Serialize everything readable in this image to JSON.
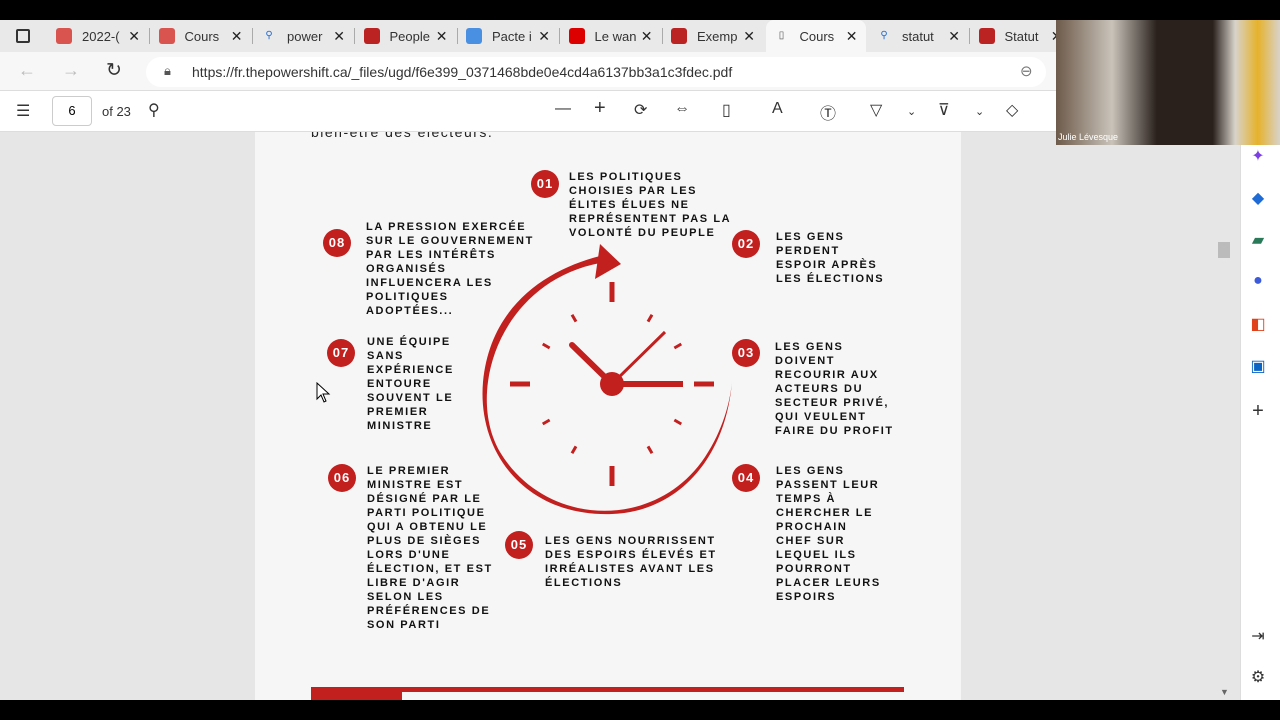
{
  "tabs": [
    {
      "label": "2022-(",
      "icon": "pdf-icon"
    },
    {
      "label": "Cours",
      "icon": "pdf-icon"
    },
    {
      "label": "power",
      "icon": "search-icon"
    },
    {
      "label": "People",
      "icon": "site-icon"
    },
    {
      "label": "Pacte i",
      "icon": "un-icon"
    },
    {
      "label": "Le wan",
      "icon": "cbc-icon"
    },
    {
      "label": "Exemp",
      "icon": "site-icon"
    },
    {
      "label": "Cours",
      "icon": "document-icon",
      "active": true
    },
    {
      "label": "statut",
      "icon": "search-icon"
    },
    {
      "label": "Statut",
      "icon": "site-icon"
    }
  ],
  "url": "https://fr.thepowershift.ca/_files/ugd/f6e399_0371468bde0e4cd4a6137bb3a1c3fdec.pdf",
  "pdf": {
    "page": "6",
    "of": "of 23"
  },
  "cam": {
    "name": "Julie Lévesque"
  },
  "doc": {
    "cut_line": "bien-être des électeurs.",
    "items": [
      {
        "num": "01",
        "text": "LES POLITIQUES\nCHOISIES PAR LES\nÉLITES ÉLUES NE\nREPRÉSENTENT PAS LA\nVOLONTÉ DU PEUPLE"
      },
      {
        "num": "02",
        "text": "LES GENS\nPERDENT\nESPOIR APRÈS\nLES ÉLECTIONS"
      },
      {
        "num": "03",
        "text": "LES GENS\nDOIVENT\nRECOURIR AUX\nACTEURS DU\nSECTEUR PRIVÉ,\nQUI VEULENT\nFAIRE DU PROFIT"
      },
      {
        "num": "04",
        "text": "LES GENS\nPASSENT LEUR\nTEMPS À\nCHERCHER LE\nPROCHAIN\nCHEF SUR\nLEQUEL ILS\nPOURRONT\nPLACER LEURS\nESPOIRS"
      },
      {
        "num": "05",
        "text": "LES GENS NOURRISSENT\nDES ESPOIRS ÉLEVÉS ET\nIRRÉALISTES AVANT LES\nÉLECTIONS"
      },
      {
        "num": "06",
        "text": "LE PREMIER\nMINISTRE EST\nDÉSIGNÉ PAR LE\nPARTI POLITIQUE\nQUI A OBTENU LE\nPLUS DE SIÈGES\nLORS D'UNE\nÉLECTION, ET EST\nLIBRE D'AGIR\nSELON LES\nPRÉFÉRENCES DE\nSON PARTI"
      },
      {
        "num": "07",
        "text": "UNE ÉQUIPE\nSANS\nEXPÉRIENCE\nENTOURE\nSOUVENT LE\nPREMIER\nMINISTRE"
      },
      {
        "num": "08",
        "text": "LA PRESSION EXERCÉE\nSUR LE GOUVERNEMENT\nPAR LES INTÉRÊTS\nORGANISÉS\nINFLUENCERA LES\nPOLITIQUES\nADOPTÉES..."
      }
    ]
  },
  "colors": {
    "accent": "#c21f1f"
  }
}
